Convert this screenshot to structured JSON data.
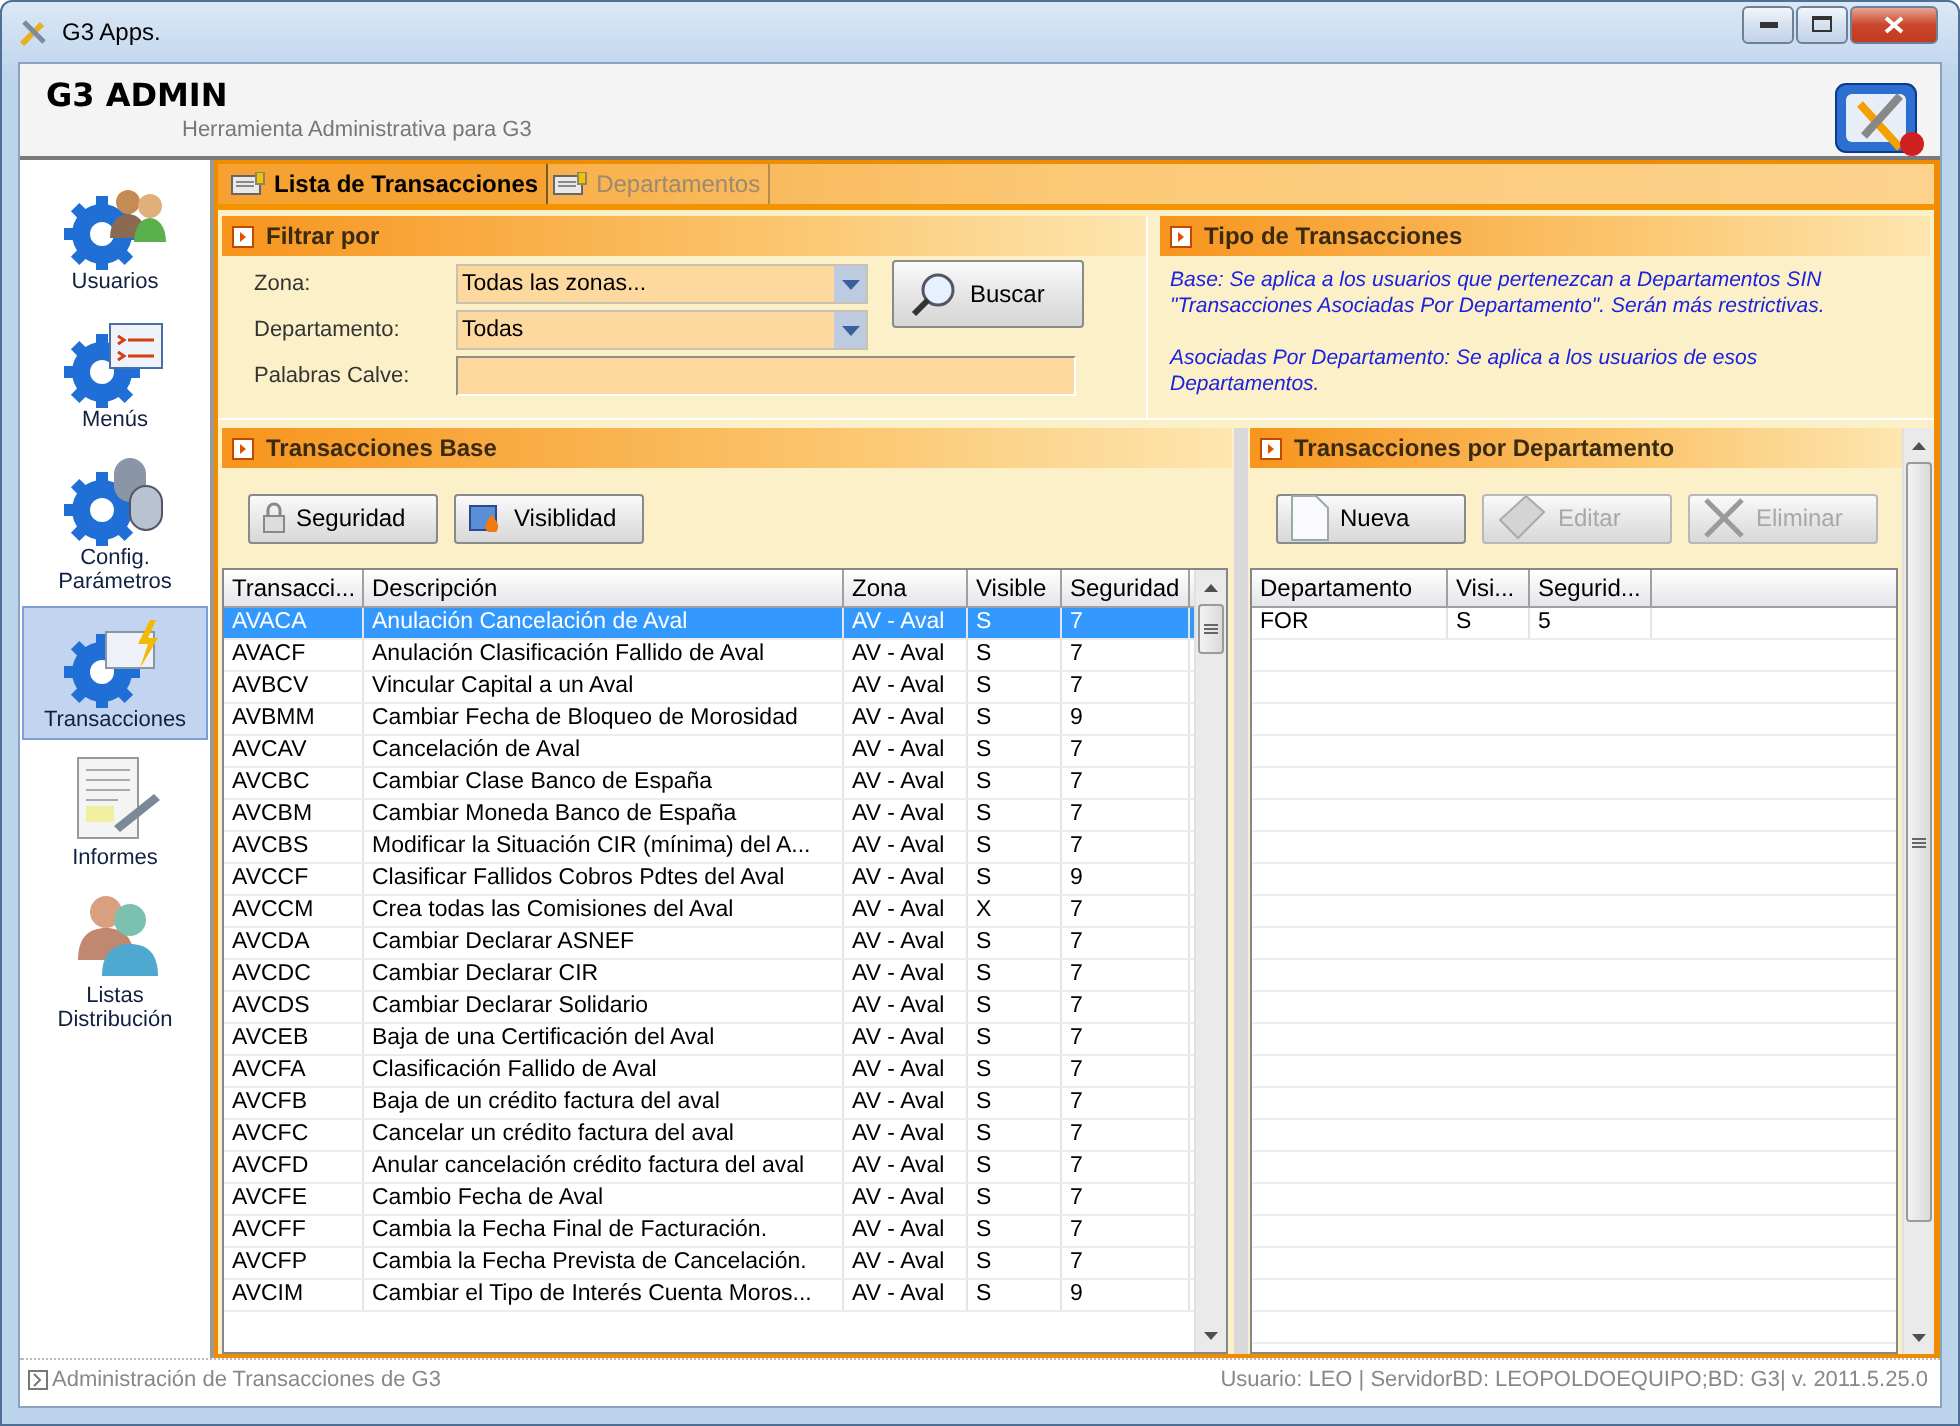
{
  "window": {
    "title": "G3 Apps."
  },
  "header": {
    "title": "G3 ADMIN",
    "subtitle": "Herramienta Administrativa para G3"
  },
  "sidebar": {
    "items": [
      {
        "label": "Usuarios",
        "selected": false
      },
      {
        "label": "Menús",
        "selected": false
      },
      {
        "label": "Config.\nParámetros",
        "selected": false
      },
      {
        "label": "Transacciones",
        "selected": true
      },
      {
        "label": "Informes",
        "selected": false
      },
      {
        "label": "Listas\nDistribución",
        "selected": false
      }
    ]
  },
  "tabs": [
    {
      "label": "Lista de Transacciones",
      "selected": true
    },
    {
      "label": "Departamentos",
      "selected": false
    }
  ],
  "filter": {
    "title": "Filtrar por",
    "fields": [
      {
        "label": "Zona:",
        "kind": "dropdown",
        "value": "Todas las zonas..."
      },
      {
        "label": "Departamento:",
        "kind": "dropdown",
        "value": "Todas"
      },
      {
        "label": "Palabras Calve:",
        "kind": "text"
      }
    ],
    "search_button": "Buscar"
  },
  "types": {
    "title": "Tipo de Transacciones",
    "paragraphs": [
      "Base: Se aplica a los usuarios  que pertenezcan a Departamentos SIN \"Transacciones Asociadas Por Departamento\". Serán más restrictivas.",
      "Asociadas Por Departamento: Se aplica a los usuarios de esos Departamentos."
    ]
  },
  "base": {
    "title": "Transacciones Base",
    "buttons": [
      {
        "label": "Seguridad",
        "disabled": false
      },
      {
        "label": "Visiblidad",
        "disabled": false
      }
    ],
    "table": {
      "columns": [
        "Transacci...",
        "Descripción",
        "Zona",
        "Visible",
        "Seguridad"
      ],
      "rows": [
        {
          "cells": [
            "AVACA",
            "Anulación Cancelación de Aval",
            "AV - Aval",
            "S",
            "7"
          ],
          "selected": true
        },
        {
          "cells": [
            "AVACF",
            "Anulación Clasificación Fallido de Aval",
            "AV - Aval",
            "S",
            "7"
          ],
          "selected": false
        },
        {
          "cells": [
            "AVBCV",
            "Vincular Capital a un Aval",
            "AV - Aval",
            "S",
            "7"
          ],
          "selected": false
        },
        {
          "cells": [
            "AVBMM",
            "Cambiar Fecha de Bloqueo de Morosidad",
            "AV - Aval",
            "S",
            "9"
          ],
          "selected": false
        },
        {
          "cells": [
            "AVCAV",
            "Cancelación de Aval",
            "AV - Aval",
            "S",
            "7"
          ],
          "selected": false
        },
        {
          "cells": [
            "AVCBC",
            "Cambiar Clase Banco de España",
            "AV - Aval",
            "S",
            "7"
          ],
          "selected": false
        },
        {
          "cells": [
            "AVCBM",
            "Cambiar Moneda Banco de España",
            "AV - Aval",
            "S",
            "7"
          ],
          "selected": false
        },
        {
          "cells": [
            "AVCBS",
            "Modificar la Situación CIR (mínima) del A...",
            "AV - Aval",
            "S",
            "7"
          ],
          "selected": false
        },
        {
          "cells": [
            "AVCCF",
            "Clasificar Fallidos Cobros Pdtes del Aval",
            "AV - Aval",
            "S",
            "9"
          ],
          "selected": false
        },
        {
          "cells": [
            "AVCCM",
            "Crea todas las Comisiones del Aval",
            "AV - Aval",
            "X",
            "7"
          ],
          "selected": false
        },
        {
          "cells": [
            "AVCDA",
            "Cambiar Declarar ASNEF",
            "AV - Aval",
            "S",
            "7"
          ],
          "selected": false
        },
        {
          "cells": [
            "AVCDC",
            "Cambiar Declarar CIR",
            "AV - Aval",
            "S",
            "7"
          ],
          "selected": false
        },
        {
          "cells": [
            "AVCDS",
            "Cambiar Declarar Solidario",
            "AV - Aval",
            "S",
            "7"
          ],
          "selected": false
        },
        {
          "cells": [
            "AVCEB",
            "Baja de una Certificación del Aval",
            "AV - Aval",
            "S",
            "7"
          ],
          "selected": false
        },
        {
          "cells": [
            "AVCFA",
            "Clasificación Fallido de Aval",
            "AV - Aval",
            "S",
            "7"
          ],
          "selected": false
        },
        {
          "cells": [
            "AVCFB",
            "Baja de un crédito factura del aval",
            "AV - Aval",
            "S",
            "7"
          ],
          "selected": false
        },
        {
          "cells": [
            "AVCFC",
            "Cancelar un crédito factura del aval",
            "AV - Aval",
            "S",
            "7"
          ],
          "selected": false
        },
        {
          "cells": [
            "AVCFD",
            "Anular cancelación crédito factura del aval",
            "AV - Aval",
            "S",
            "7"
          ],
          "selected": false
        },
        {
          "cells": [
            "AVCFE",
            "Cambio Fecha de Aval",
            "AV - Aval",
            "S",
            "7"
          ],
          "selected": false
        },
        {
          "cells": [
            "AVCFF",
            "Cambia la Fecha Final de Facturación.",
            "AV - Aval",
            "S",
            "7"
          ],
          "selected": false
        },
        {
          "cells": [
            "AVCFP",
            "Cambia la Fecha Prevista de Cancelación.",
            "AV - Aval",
            "S",
            "7"
          ],
          "selected": false
        },
        {
          "cells": [
            "AVCIM",
            "Cambiar el Tipo de Interés Cuenta Moros...",
            "AV - Aval",
            "S",
            "9"
          ],
          "selected": false
        }
      ]
    }
  },
  "department": {
    "title": "Transacciones por Departamento",
    "buttons": [
      {
        "label": "Nueva",
        "disabled": false
      },
      {
        "label": "Editar",
        "disabled": true
      },
      {
        "label": "Eliminar",
        "disabled": true
      }
    ],
    "table": {
      "columns": [
        "Departamento",
        "Visi...",
        "Segurid..."
      ],
      "rows": [
        {
          "cells": [
            "FOR",
            "S",
            "5"
          ],
          "selected": false
        }
      ]
    }
  },
  "status_bar": {
    "left": "Administración de Transacciones de G3",
    "right": "Usuario: LEO  |  ServidorBD: LEOPOLDOEQUIPO;BD: G3|  v. 2011.5.25.0"
  }
}
